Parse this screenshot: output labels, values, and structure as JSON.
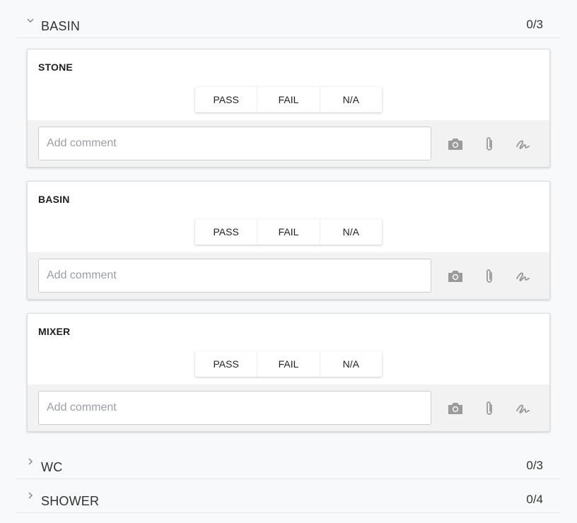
{
  "sections": [
    {
      "title": "BASIN",
      "count": "0/3",
      "expanded": true
    },
    {
      "title": "WC",
      "count": "0/3",
      "expanded": false
    },
    {
      "title": "SHOWER",
      "count": "0/4",
      "expanded": false
    }
  ],
  "cards": [
    {
      "title": "STONE",
      "options": [
        "PASS",
        "FAIL",
        "N/A"
      ],
      "comment_placeholder": "Add comment",
      "comment_value": ""
    },
    {
      "title": "BASIN",
      "options": [
        "PASS",
        "FAIL",
        "N/A"
      ],
      "comment_placeholder": "Add comment",
      "comment_value": ""
    },
    {
      "title": "MIXER",
      "options": [
        "PASS",
        "FAIL",
        "N/A"
      ],
      "comment_placeholder": "Add comment",
      "comment_value": ""
    }
  ],
  "icons": {
    "camera": "camera-icon",
    "attach": "paperclip-icon",
    "signature": "signature-icon",
    "expanded": "chevron-down-icon",
    "collapsed": "chevron-right-icon"
  },
  "colors": {
    "background": "#f8f9fa",
    "card": "#ffffff",
    "footer": "#f2f2f2",
    "icon": "#9a9a9a",
    "text": "#333333"
  }
}
